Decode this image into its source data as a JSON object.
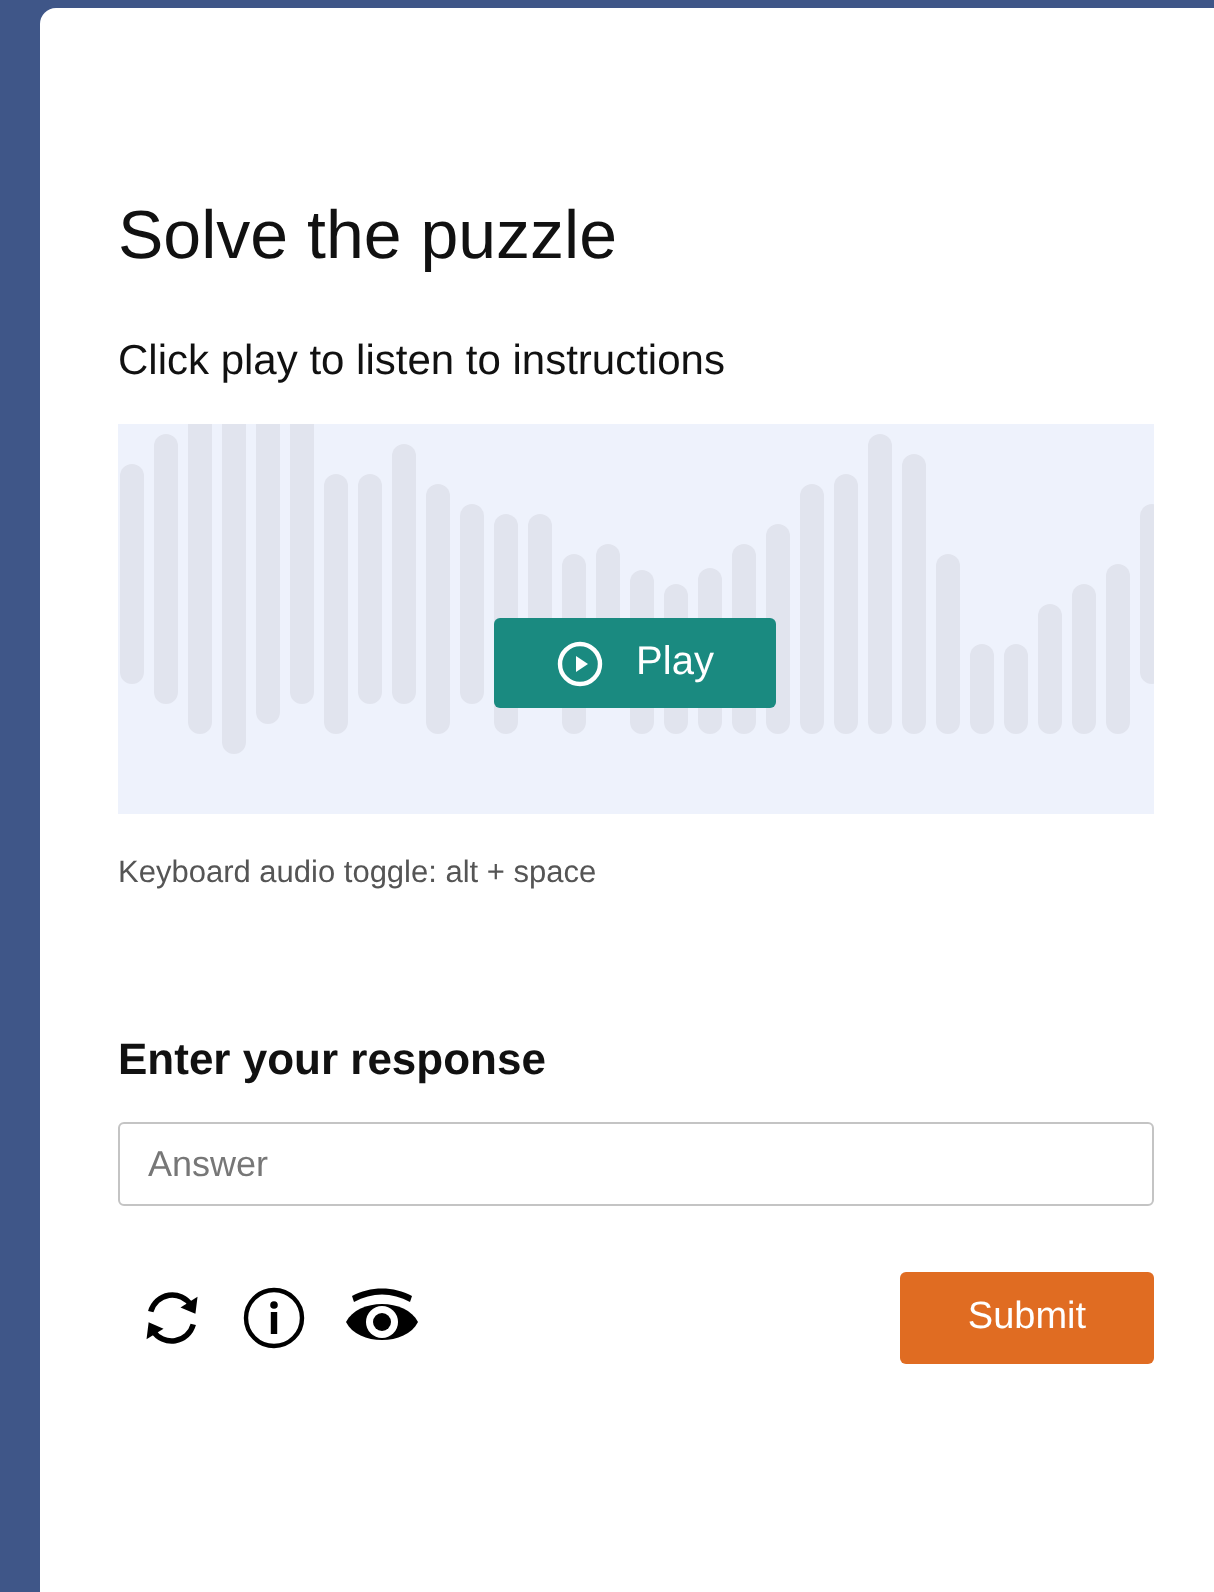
{
  "title": "Solve the puzzle",
  "instructions": "Click play to listen to instructions",
  "play_button": {
    "label": "Play"
  },
  "keyboard_hint": "Keyboard audio toggle: alt + space",
  "response": {
    "heading": "Enter your response",
    "placeholder": "Answer"
  },
  "tools": [
    {
      "kind": "refresh"
    },
    {
      "kind": "info"
    },
    {
      "kind": "eye"
    }
  ],
  "submit_button": {
    "label": "Submit"
  }
}
